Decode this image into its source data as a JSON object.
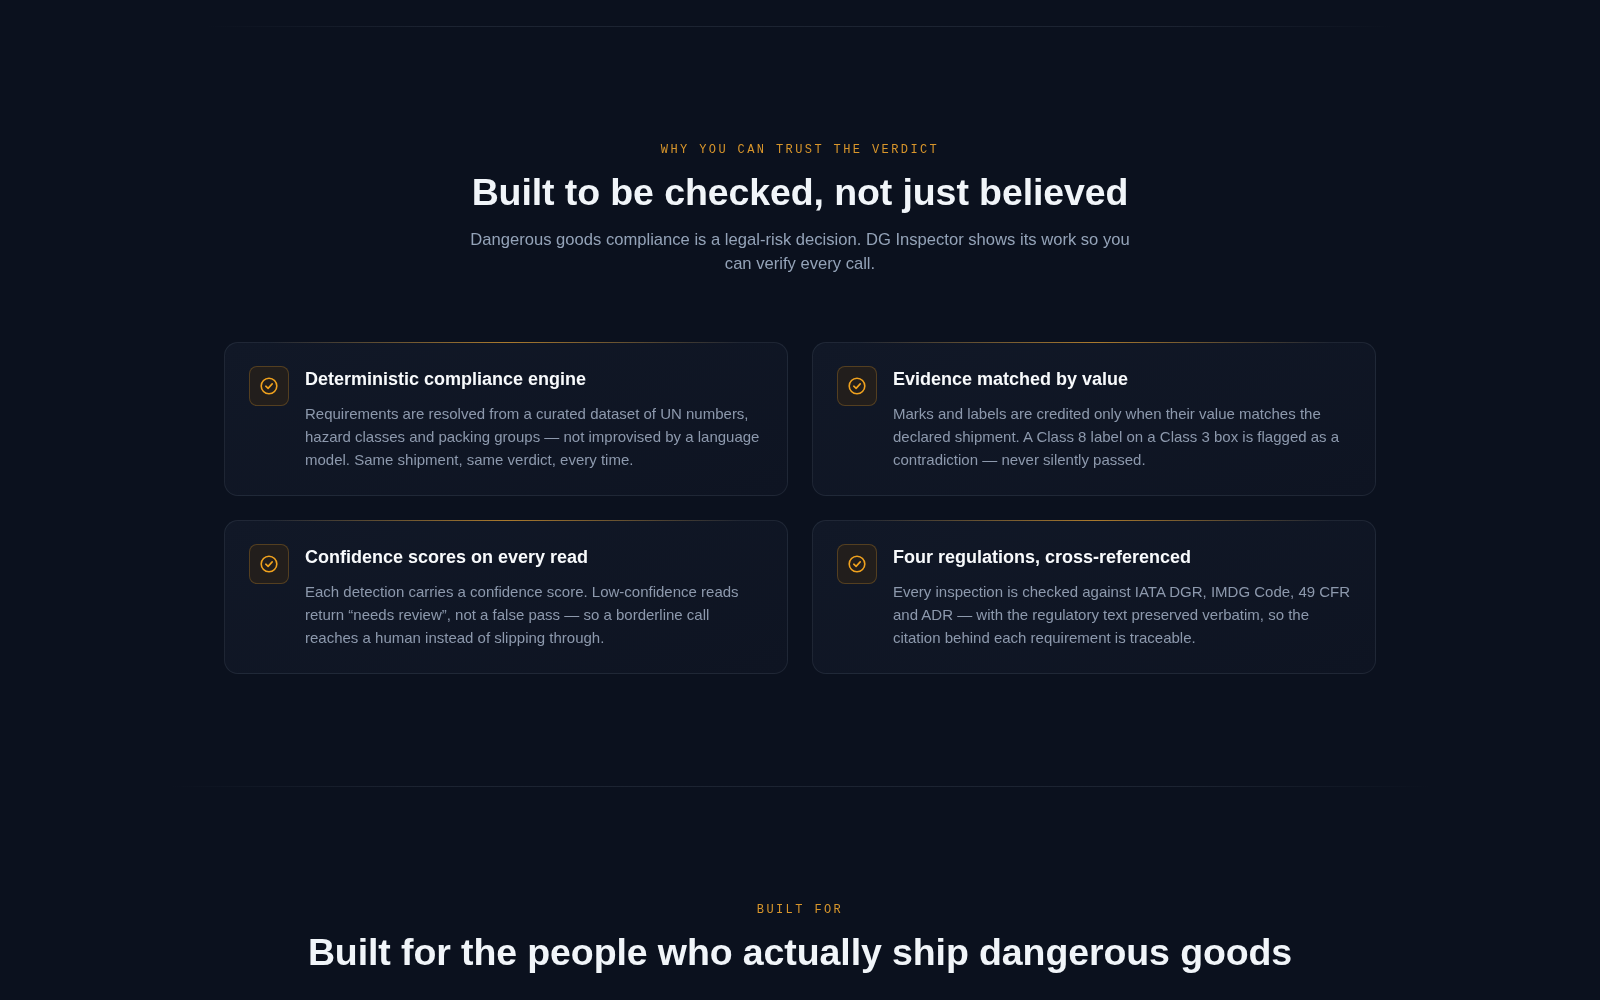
{
  "trust_section": {
    "eyebrow": "WHY YOU CAN TRUST THE VERDICT",
    "heading": "Built to be checked, not just believed",
    "subtitle": "Dangerous goods compliance is a legal-risk decision. DG Inspector shows its work so you can verify every call.",
    "features": [
      {
        "title": "Deterministic compliance engine",
        "description": "Requirements are resolved from a curated dataset of UN numbers, hazard classes and packing groups — not improvised by a language model. Same shipment, same verdict, every time."
      },
      {
        "title": "Evidence matched by value",
        "description": "Marks and labels are credited only when their value matches the declared shipment. A Class 8 label on a Class 3 box is flagged as a contradiction — never silently passed."
      },
      {
        "title": "Confidence scores on every read",
        "description": "Each detection carries a confidence score. Low-confidence reads return “needs review”, not a false pass — so a borderline call reaches a human instead of slipping through."
      },
      {
        "title": "Four regulations, cross-referenced",
        "description": "Every inspection is checked against IATA DGR, IMDG Code, 49 CFR and ADR — with the regulatory text preserved verbatim, so the citation behind each requirement is traceable."
      }
    ]
  },
  "built_for_section": {
    "eyebrow": "BUILT FOR",
    "heading": "Built for the people who actually ship dangerous goods"
  }
}
